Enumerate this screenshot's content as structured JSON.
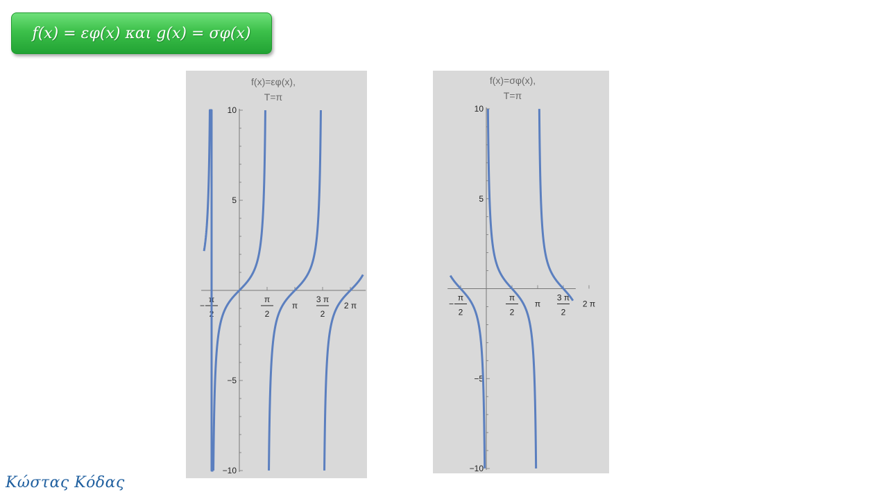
{
  "slide": {
    "title": "f(x) = εφ(x) και g(x) = σφ(x)",
    "author": "Κώστας Κόδας"
  },
  "colors": {
    "title_fill": "#3cc04a",
    "curve": "#5b7fbf",
    "plot_bg": "#d9d9d9",
    "author": "#1f5f9f"
  },
  "chart_data": [
    {
      "type": "line",
      "function": "tan",
      "title_lines": [
        "f(x)=εφ(x),",
        "T=π"
      ],
      "xlim": [
        -2.0,
        7.0
      ],
      "ylim": [
        -10,
        10
      ],
      "y_ticks": [
        {
          "value": 10,
          "label": "10"
        },
        {
          "value": 5,
          "label": "5"
        },
        {
          "value": -5,
          "label": "−5"
        },
        {
          "value": -10,
          "label": "−10"
        }
      ],
      "x_ticks": [
        {
          "value": -1.5708,
          "sign": "−",
          "num": "π",
          "den": "2"
        },
        {
          "value": 1.5708,
          "num": "π",
          "den": "2"
        },
        {
          "value": 3.1416,
          "label": "π"
        },
        {
          "value": 4.7124,
          "num": "3 π",
          "den": "2"
        },
        {
          "value": 6.2832,
          "label": "2 π"
        }
      ],
      "series": [
        {
          "x_range": [
            -2.0,
            -1.4713
          ]
        },
        {
          "x_range": [
            -1.4711,
            1.4711
          ]
        },
        {
          "x_range": [
            1.6705,
            4.6129
          ]
        },
        {
          "x_range": [
            4.8121,
            7.0
          ]
        }
      ]
    },
    {
      "type": "line",
      "function": "cot",
      "title_lines": [
        "f(x)=σφ(x),",
        "T=π"
      ],
      "xlim": [
        -2.2,
        5.3
      ],
      "ylim": [
        -10,
        10
      ],
      "y_ticks": [
        {
          "value": 10,
          "label": "10"
        },
        {
          "value": 5,
          "label": "5"
        },
        {
          "value": -5,
          "label": "−5"
        },
        {
          "value": -10,
          "label": "−10"
        }
      ],
      "x_ticks": [
        {
          "value": -1.5708,
          "sign": "−",
          "num": "π",
          "den": "2"
        },
        {
          "value": 1.5708,
          "num": "π",
          "den": "2"
        },
        {
          "value": 3.1416,
          "label": "π"
        },
        {
          "value": 4.7124,
          "num": "3 π",
          "den": "2"
        },
        {
          "value": 6.2832,
          "label": "2 π"
        }
      ],
      "series": [
        {
          "x_range": [
            -2.2,
            -0.0997
          ]
        },
        {
          "x_range": [
            0.0997,
            3.0419
          ]
        },
        {
          "x_range": [
            3.2413,
            5.3
          ]
        }
      ]
    }
  ]
}
